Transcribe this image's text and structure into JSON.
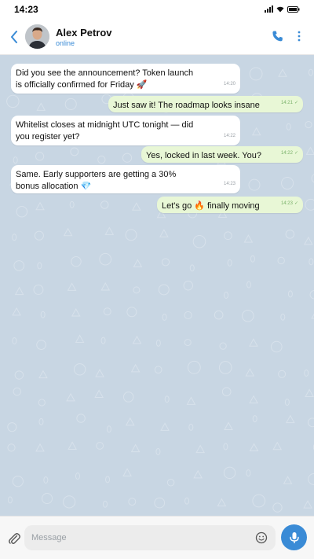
{
  "status_bar": {
    "time": "14:23"
  },
  "header": {
    "contact_name": "Alex Petrov",
    "contact_status": "online",
    "status_color": "#3a8bd6"
  },
  "messages": [
    {
      "direction": "incoming",
      "text": "Did you see the announcement? Token launch\nis officially confirmed for Friday 🚀",
      "time": "14:20",
      "read": false
    },
    {
      "direction": "outgoing",
      "text": "Just saw it! The roadmap looks insane",
      "time": "14:21",
      "read": true
    },
    {
      "direction": "incoming",
      "text": "Whitelist closes at midnight UTC tonight — did\nyou register yet?",
      "time": "14:22",
      "read": false
    },
    {
      "direction": "outgoing",
      "text": "Yes, locked in last week. You?",
      "time": "14:22",
      "read": true
    },
    {
      "direction": "incoming",
      "text": "Same. Early supporters are getting a 30%\nbonus allocation 💎",
      "time": "14:23",
      "read": false
    },
    {
      "direction": "outgoing",
      "text": "Let's go 🔥 finally moving",
      "time": "14:23",
      "read": true
    }
  ],
  "composer": {
    "placeholder": "Message"
  },
  "colors": {
    "accent": "#3a8bd6",
    "chat_background": "#c8d6e3",
    "outgoing_bubble": "#e8f7d6",
    "incoming_bubble": "#ffffff"
  },
  "icons": {
    "back": "chevron-left-icon",
    "call": "phone-icon",
    "more": "kebab-menu-icon",
    "attach": "paperclip-icon",
    "emoji": "smiley-icon",
    "mic": "microphone-icon"
  }
}
